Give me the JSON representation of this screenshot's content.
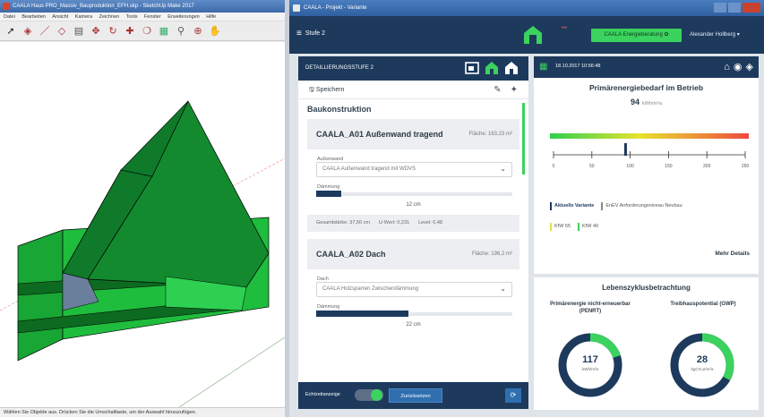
{
  "sketchup": {
    "title": "CAALA Haus PRO_Massiv_Bauproduktion_EFH.skp - SketchUp Make 2017",
    "menu": [
      "Datei",
      "Bearbeiten",
      "Ansicht",
      "Kamera",
      "Zeichnen",
      "Tools",
      "Fenster",
      "Erweiterungen",
      "Hilfe"
    ],
    "toolbar_icons": [
      "select-icon",
      "eraser-icon",
      "pencil-icon",
      "shape-icon",
      "push-pull-icon",
      "move-icon",
      "rotate-icon",
      "scale-icon",
      "offset-icon",
      "tape-icon",
      "paint-icon",
      "orbit-icon",
      "pan-icon"
    ],
    "status": "Wählen Sie Objekte aus. Drücken Sie die Umschalttaste, um der Auswahl hinzuzufügen."
  },
  "caala": {
    "window_title": "CAALA - Projekt - Variante",
    "nav": {
      "menu_label": "Stufe 2",
      "energy_button": "CAALA Energieberatung",
      "user": "Alexander Hollberg"
    },
    "left": {
      "header": "DETAILLIERUNGSSTUFE 2",
      "save_label": "Speichern",
      "section": "Baukonstruktion",
      "items": [
        {
          "name": "CAALA_A01 Außenwand tragend",
          "area": "Fläche: 163,23 m²",
          "select_label": "Außenwand",
          "select_value": "CAALA Außenwand tragend mit WDVS",
          "slider_label": "Dämmung",
          "slider_fraction": 0.13,
          "slider_value": "12 cm",
          "meta": [
            "Gesamtstärke: 37,50 cm",
            "U-Wert: 0,231",
            "Level: 0,48"
          ]
        },
        {
          "name": "CAALA_A02 Dach",
          "area": "Fläche: 196,2 m²",
          "select_label": "Dach",
          "select_value": "CAALA Holzsparren Zwischendämmung",
          "slider_label": "Dämmung",
          "slider_fraction": 0.47,
          "slider_value": "22 cm"
        }
      ],
      "footer": {
        "toggle_label": "Echtzeitanzeige",
        "button": "Zurücksetzen"
      }
    },
    "right": {
      "date": "18.10.2017 10:56:48",
      "title": "Primärenergiebedarf im Betrieb",
      "value": "94",
      "unit": "kWh/m²a",
      "scale_ticks": [
        "0",
        "50",
        "100",
        "150",
        "200",
        "250"
      ],
      "legend": [
        "Aktuelle Variante",
        "EnEV Anforderungsniveau Neubau",
        "KfW 55",
        "KfW 40"
      ],
      "more_link": "Mehr Details"
    },
    "lifecycle": {
      "title": "Lebenszyklusbetrachtung",
      "col1": "Primärenergie nicht-erneuerbar (PENRT)",
      "col2": "Treibhauspotential (GWP)",
      "ring1_value": "117",
      "ring1_unit": "kWh/m²a",
      "ring1_fraction": 0.2,
      "ring2_value": "28",
      "ring2_unit": "kgCO₂e/m²a",
      "ring2_fraction": 0.33
    },
    "colors": {
      "navy": "#1d3a5d",
      "accent": "#3bd25e",
      "model_green": "#1aa33a"
    }
  }
}
